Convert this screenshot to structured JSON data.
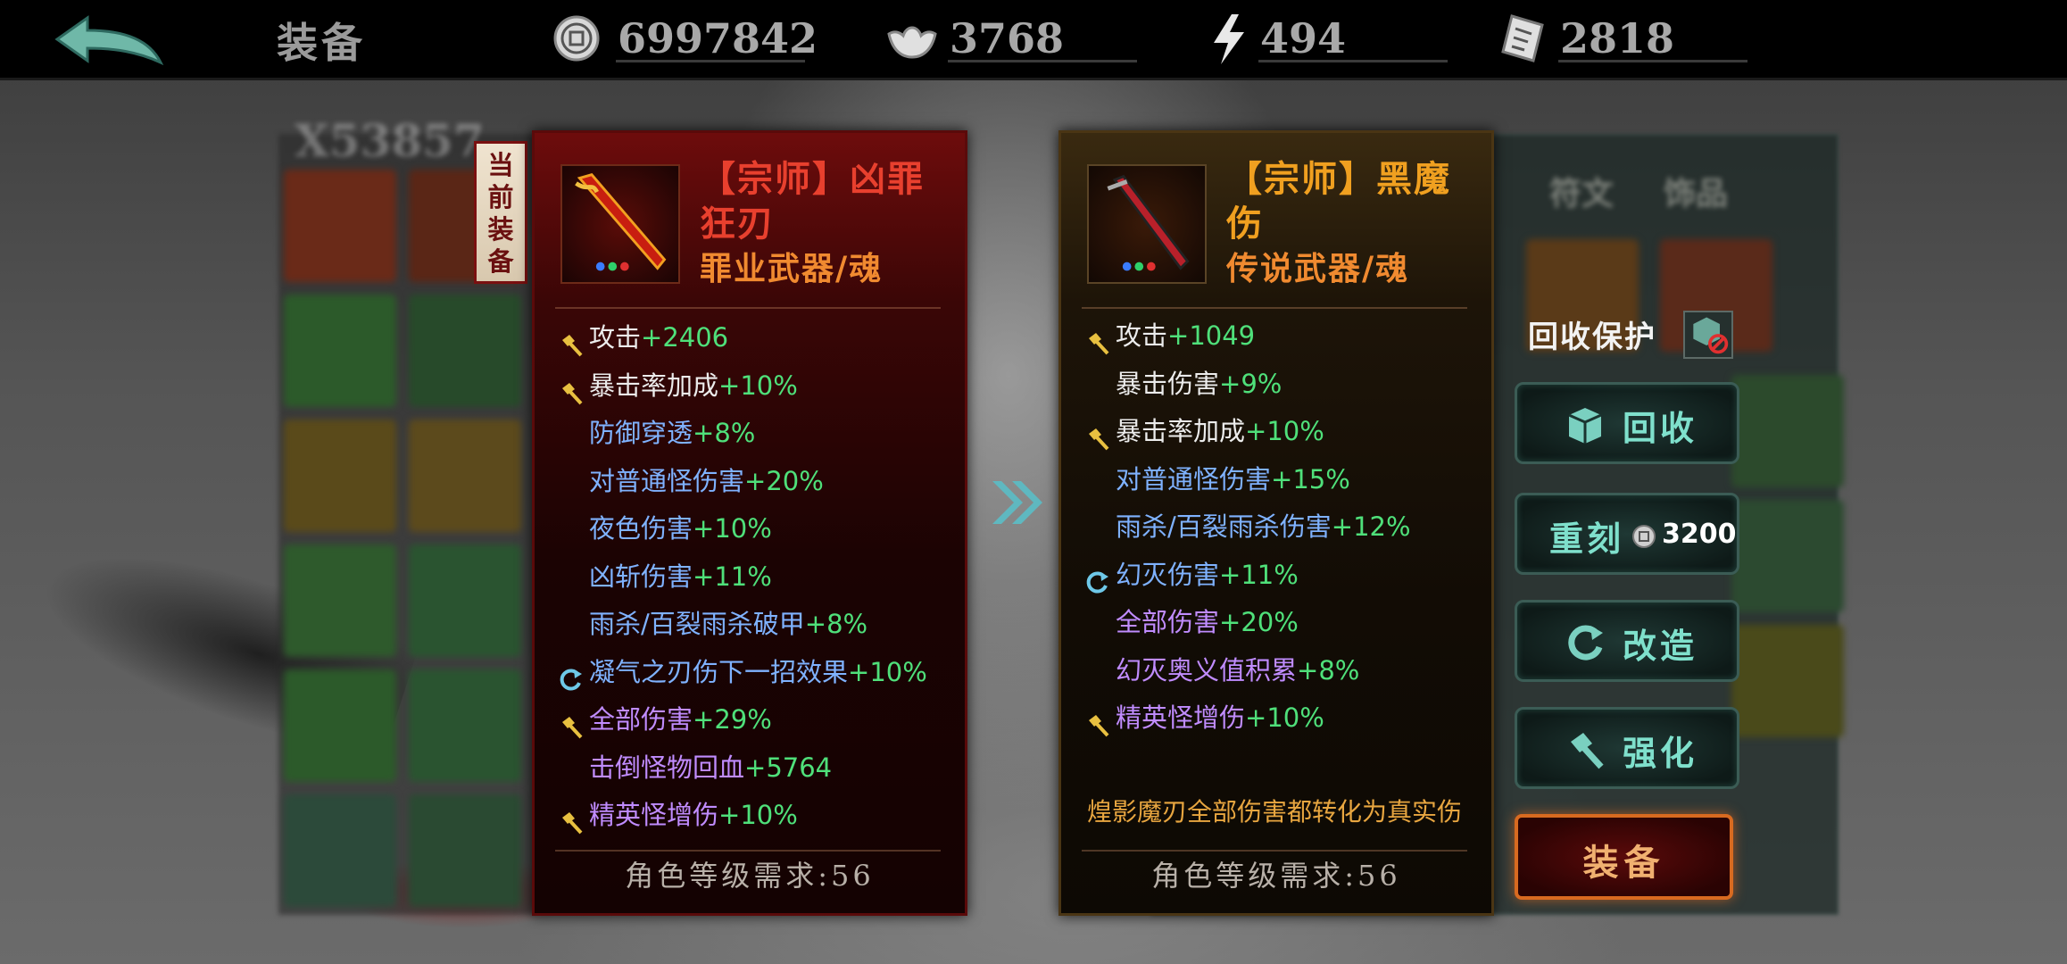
{
  "header": {
    "title": "装备",
    "currencies": [
      {
        "icon": "coin-icon",
        "value": "6997842"
      },
      {
        "icon": "ingot-icon",
        "value": "3768"
      },
      {
        "icon": "lightning-icon",
        "value": "494"
      },
      {
        "icon": "scroll-ticket-icon",
        "value": "2818"
      }
    ]
  },
  "inventory": {
    "count_label": "X53857",
    "right_tabs": [
      "符文",
      "饰品"
    ]
  },
  "current_tag": [
    "当",
    "前",
    "装",
    "备"
  ],
  "current_item": {
    "title_line1": "【宗师】凶罪",
    "title_line2": "狂刃",
    "type": "罪业武器/魂",
    "stats": [
      {
        "icon": "hammer-icon",
        "label": "攻击",
        "value": "+2406",
        "label_color": "white"
      },
      {
        "icon": "hammer-icon",
        "label": "暴击率加成",
        "value": "+10%",
        "label_color": "white"
      },
      {
        "icon": "",
        "label": "防御穿透",
        "value": "+8%",
        "label_color": "blue"
      },
      {
        "icon": "",
        "label": "对普通怪伤害",
        "value": "+20%",
        "label_color": "blue"
      },
      {
        "icon": "",
        "label": "夜色伤害",
        "value": "+10%",
        "label_color": "blue"
      },
      {
        "icon": "",
        "label": "凶斩伤害",
        "value": "+11%",
        "label_color": "blue"
      },
      {
        "icon": "",
        "label": "雨杀/百裂雨杀破甲",
        "value": "+8%",
        "label_color": "blue"
      },
      {
        "icon": "refresh-icon",
        "label": "凝气之刃伤下一招效果",
        "value": "+10%",
        "label_color": "blue"
      },
      {
        "icon": "hammer-icon",
        "label": "全部伤害",
        "value": "+29%",
        "label_color": "purple"
      },
      {
        "icon": "",
        "label": "击倒怪物回血",
        "value": "+5764",
        "label_color": "purple"
      },
      {
        "icon": "hammer-icon",
        "label": "精英怪增伤",
        "value": "+10%",
        "label_color": "purple"
      }
    ],
    "requirement": "角色等级需求:56"
  },
  "new_item": {
    "title_line1": "【宗师】黑魔",
    "title_line2": "伤",
    "type": "传说武器/魂",
    "stats": [
      {
        "icon": "hammer-icon",
        "label": "攻击",
        "value": "+1049",
        "label_color": "white"
      },
      {
        "icon": "",
        "label": "暴击伤害",
        "value": "+9%",
        "label_color": "white"
      },
      {
        "icon": "hammer-icon",
        "label": "暴击率加成",
        "value": "+10%",
        "label_color": "white"
      },
      {
        "icon": "",
        "label": "对普通怪伤害",
        "value": "+15%",
        "label_color": "blue"
      },
      {
        "icon": "",
        "label": "雨杀/百裂雨杀伤害",
        "value": "+12%",
        "label_color": "blue"
      },
      {
        "icon": "refresh-icon",
        "label": "幻灭伤害",
        "value": "+11%",
        "label_color": "blue"
      },
      {
        "icon": "",
        "label": "全部伤害",
        "value": "+20%",
        "label_color": "purple"
      },
      {
        "icon": "",
        "label": "幻灭奥义值积累",
        "value": "+8%",
        "label_color": "purple"
      },
      {
        "icon": "hammer-icon",
        "label": "精英怪增伤",
        "value": "+10%",
        "label_color": "purple"
      }
    ],
    "description": "煌影魔刃全部伤害都转化为真实伤",
    "requirement": "角色等级需求:56"
  },
  "actions": {
    "protect_label": "回收保护",
    "recycle_label": "回收",
    "reforge_label": "重刻",
    "reforge_cost": "3200",
    "modify_label": "改造",
    "strengthen_label": "强化",
    "equip_label": "装备"
  },
  "colors": {
    "stat_value": "#4fe07a",
    "white": "#ececec",
    "blue": "#7fb2ff",
    "purple": "#c08cff",
    "current_title": "#e8402e",
    "new_title": "#f0a020",
    "item_type": "#f08a30",
    "action_text": "#7fe0cc",
    "equip_border": "#d86a20"
  }
}
